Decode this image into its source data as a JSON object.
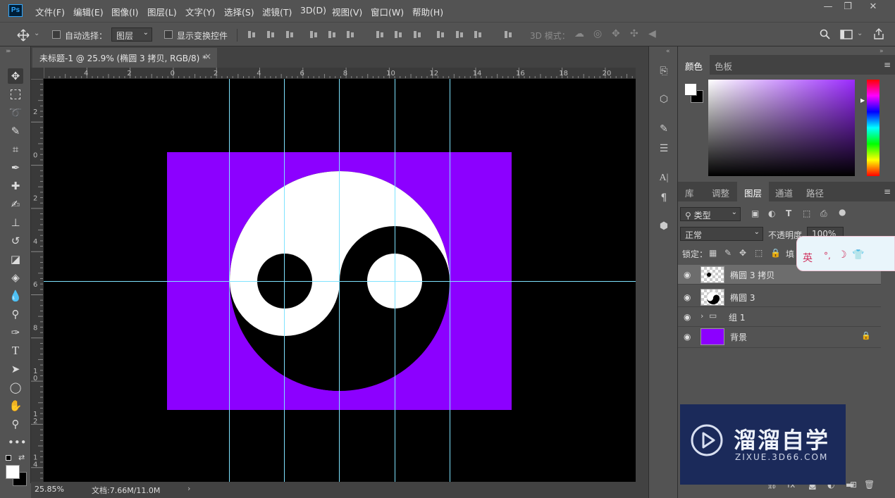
{
  "app": {
    "logo": "Ps"
  },
  "menu": [
    "文件(F)",
    "编辑(E)",
    "图像(I)",
    "图层(L)",
    "文字(Y)",
    "选择(S)",
    "滤镜(T)",
    "3D(D)",
    "视图(V)",
    "窗口(W)",
    "帮助(H)"
  ],
  "window_controls": {
    "minimize": "—",
    "restore": "❐",
    "close": "✕"
  },
  "options": {
    "auto_select_label": "自动选择：",
    "auto_select_value": "图层",
    "show_transform_label": "显示变换控件",
    "mode_3d_label": "3D 模式："
  },
  "document": {
    "tab_title": "未标题-1 @ 25.9% (椭圆 3 拷贝, RGB/8) *",
    "tab_close": "×"
  },
  "ruler": {
    "top_labels": [
      "4",
      "2",
      "0",
      "2",
      "4",
      "6",
      "8",
      "10",
      "12",
      "14",
      "16",
      "18",
      "20"
    ],
    "left_labels": [
      "2",
      "0",
      "2",
      "4",
      "6",
      "8",
      "1 0",
      "1 2",
      "1 4"
    ]
  },
  "status": {
    "zoom": "25.85%",
    "doc_info": "文档:7.66M/11.0M",
    "arrow": "›"
  },
  "colors": {
    "canvas_bg": "#000000",
    "artboard": "#8c00ff",
    "guide": "#7fe3ff",
    "yin": "#ffffff",
    "yang": "#000000",
    "fg_swatch": "#ffffff",
    "bg_swatch": "#000000"
  },
  "color_panel": {
    "tabs": [
      "颜色",
      "色板"
    ],
    "active": "颜色"
  },
  "layers_panel": {
    "tabs": [
      "库",
      "调整",
      "图层",
      "通道",
      "路径"
    ],
    "active": "图层",
    "filter_kind": "类型",
    "blend_mode": "正常",
    "opacity_label": "不透明度",
    "opacity_value": "100%",
    "lock_label": "锁定：",
    "fill_label": "填",
    "layers": [
      {
        "name": "椭圆 3 拷贝",
        "selected": true,
        "thumb": "dot"
      },
      {
        "name": "椭圆 3",
        "selected": false,
        "thumb": "yinyang"
      },
      {
        "name": "组 1",
        "selected": false,
        "thumb": "folder",
        "group": true
      },
      {
        "name": "背景",
        "selected": false,
        "thumb": "purple",
        "locked": true
      }
    ]
  },
  "ime": {
    "lang": "英",
    "icons": [
      "moon-icon",
      "shirt-icon"
    ]
  },
  "watermark": {
    "title": "溜溜自学",
    "subtitle": "ZIXUE.3D66.COM"
  },
  "icons": {
    "move": "move-icon",
    "marquee": "rect-marquee-icon",
    "lasso": "lasso-icon",
    "quick_select": "quick-select-icon",
    "crop": "crop-icon",
    "eyedropper": "eyedropper-icon",
    "healing": "healing-brush-icon",
    "brush": "brush-icon",
    "stamp": "clone-stamp-icon",
    "history_brush": "history-brush-icon",
    "eraser": "eraser-icon",
    "bucket": "paint-bucket-icon",
    "blur": "blur-icon",
    "dodge": "dodge-icon",
    "pen": "pen-icon",
    "type": "type-icon",
    "path_select": "path-select-icon",
    "ellipse": "ellipse-icon",
    "hand": "hand-icon",
    "zoom": "zoom-icon"
  }
}
